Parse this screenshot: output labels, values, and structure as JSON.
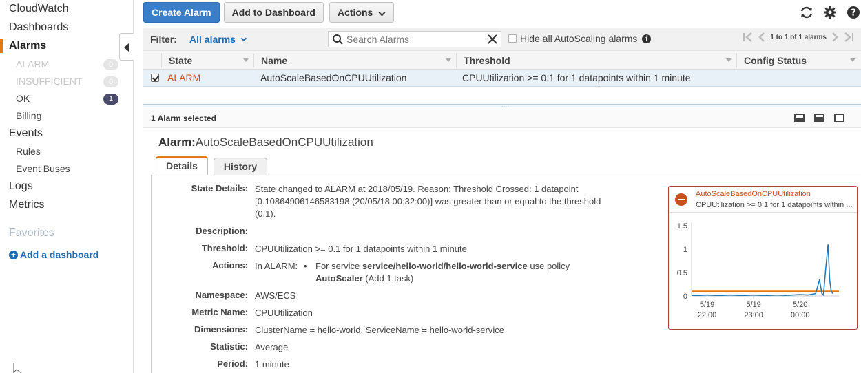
{
  "sidebar": {
    "items": [
      {
        "label": "CloudWatch"
      },
      {
        "label": "Dashboards"
      },
      {
        "label": "Alarms"
      },
      {
        "label": "ALARM",
        "count": "0"
      },
      {
        "label": "INSUFFICIENT",
        "count": "0"
      },
      {
        "label": "OK",
        "count": "1"
      },
      {
        "label": "Billing"
      },
      {
        "label": "Events"
      },
      {
        "label": "Rules"
      },
      {
        "label": "Event Buses"
      },
      {
        "label": "Logs"
      },
      {
        "label": "Metrics"
      }
    ],
    "favorites_label": "Favorites",
    "add_dashboard_label": "Add a dashboard"
  },
  "toolbar": {
    "create_alarm": "Create Alarm",
    "add_to_dashboard": "Add to Dashboard",
    "actions": "Actions"
  },
  "filterbar": {
    "filter_label": "Filter:",
    "filter_value": "All alarms",
    "search_placeholder": "Search Alarms",
    "hide_autoscaling": "Hide all AutoScaling alarms",
    "pager_text": "1 to 1 of 1 alarms"
  },
  "table": {
    "columns": [
      "State",
      "Name",
      "Threshold",
      "Config Status"
    ],
    "rows": [
      {
        "state": "ALARM",
        "name": "AutoScaleBasedOnCPUUtilization",
        "threshold": "CPUUtilization >= 0.1 for 1 datapoints within 1 minute",
        "config_status": ""
      }
    ]
  },
  "selection": {
    "text": "1 Alarm selected"
  },
  "alarm": {
    "title_prefix": "Alarm:",
    "title_name": "AutoScaleBasedOnCPUUtilization",
    "tabs": [
      "Details",
      "History"
    ],
    "details": {
      "state_details_label": "State Details:",
      "state_details": "State changed to ALARM at 2018/05/19. Reason: Threshold Crossed: 1 datapoint [0.10864906146583198 (20/05/18 00:32:00)] was greater than or equal to the threshold (0.1).",
      "description_label": "Description:",
      "threshold_label": "Threshold:",
      "threshold": "CPUUtilization >= 0.1 for 1 datapoints within 1 minute",
      "actions_label": "Actions:",
      "actions_prefix": "In ALARM:",
      "actions_bullet_a": "For service ",
      "actions_service": "service/hello-world/hello-world-service",
      "actions_bullet_b": " use policy ",
      "actions_policy": "AutoScaler",
      "actions_bullet_c": " (Add 1 task)",
      "namespace_label": "Namespace:",
      "namespace": "AWS/ECS",
      "metric_label": "Metric Name:",
      "metric": "CPUUtilization",
      "dimensions_label": "Dimensions:",
      "dimensions": "ClusterName = hello-world, ServiceName = hello-world-service",
      "statistic_label": "Statistic:",
      "statistic": "Average",
      "period_label": "Period:",
      "period": "1 minute"
    }
  },
  "colors": {
    "accent": "#e47911",
    "link": "#1f6ab0",
    "alarm": "#c7511f",
    "primary_button": "#3a7dc9"
  },
  "chart_data": {
    "type": "line",
    "title": "AutoScaleBasedOnCPUUtilization",
    "subtitle": "CPUUtilization >= 0.1 for 1 datapoints within ...",
    "y_ticks": [
      "1.5",
      "1",
      "0.5",
      "0"
    ],
    "ylim": [
      0,
      1.5
    ],
    "x_ticks": [
      {
        "line1": "5/19",
        "line2": "22:00"
      },
      {
        "line1": "5/19",
        "line2": "23:00"
      },
      {
        "line1": "5/20",
        "line2": "00:00"
      }
    ],
    "threshold": 0.1,
    "series": [
      {
        "x_minutes": [
          0,
          10,
          20,
          30,
          40,
          50,
          60,
          70,
          80,
          90,
          100,
          110,
          120,
          130,
          140,
          150,
          160,
          165,
          168,
          170,
          173,
          176,
          178,
          180,
          182
        ],
        "values": [
          0.01,
          0.01,
          0.02,
          0.01,
          0.01,
          0.02,
          0.01,
          0.01,
          0.02,
          0.01,
          0.01,
          0.02,
          0.01,
          0.02,
          0.03,
          0.02,
          0.05,
          0.35,
          0.05,
          0.02,
          0.6,
          1.1,
          0.35,
          0.1,
          0.05
        ]
      }
    ]
  }
}
